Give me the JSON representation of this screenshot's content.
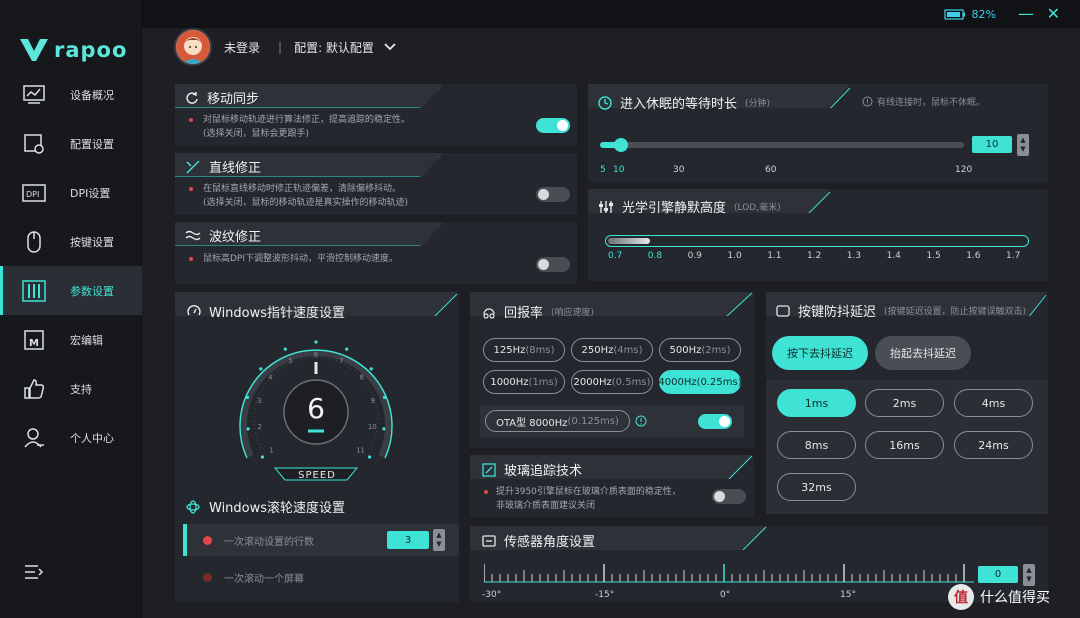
{
  "brand": {
    "name": "rapoo",
    "accent": "#3ee3d6"
  },
  "sidebar": {
    "items": [
      {
        "label": "设备概况",
        "icon": "monitor-chart-icon"
      },
      {
        "label": "配置设置",
        "icon": "config-gear-icon"
      },
      {
        "label": "DPI设置",
        "icon": "dpi-icon"
      },
      {
        "label": "按键设置",
        "icon": "mouse-icon"
      },
      {
        "label": "参数设置",
        "icon": "sliders-icon",
        "active": true
      },
      {
        "label": "宏编辑",
        "icon": "macro-icon"
      },
      {
        "label": "支持",
        "icon": "thumbs-up-icon"
      },
      {
        "label": "个人中心",
        "icon": "user-center-icon"
      }
    ]
  },
  "topbar": {
    "battery": "82%"
  },
  "user": {
    "login_status": "未登录",
    "config_label": "配置: 默认配置"
  },
  "move_sync": {
    "title": "移动同步",
    "desc1": "对鼠标移动轨迹进行算法修正，提高追踪的稳定性。",
    "desc2": "(选择关闭，鼠标会更跟手)",
    "enabled": true
  },
  "line_fix": {
    "title": "直线修正",
    "desc1": "在鼠标直线移动时修正轨迹偏差，清除偏移抖动。",
    "desc2": "(选择关闭，鼠标的移动轨迹是真实操作的移动轨迹)",
    "enabled": false
  },
  "ripple_fix": {
    "title": "波纹修正",
    "desc1": "鼠标高DPI下调整波形抖动，平滑控制移动速度。",
    "enabled": false
  },
  "sleep": {
    "title": "进入休眠的等待时长",
    "unit": "(分钟)",
    "note": "有线连接时，鼠标不休眠。",
    "value": "10",
    "ticks": [
      "5",
      "10",
      "30",
      "60",
      "120"
    ]
  },
  "lod": {
    "title": "光学引擎静默高度",
    "unit": "(LOD,毫米)",
    "ticks": [
      "0.7",
      "0.8",
      "0.9",
      "1.0",
      "1.1",
      "1.2",
      "1.3",
      "1.4",
      "1.5",
      "1.6",
      "1.7"
    ],
    "value": 0.8
  },
  "pointer_speed": {
    "title": "Windows指针速度设置",
    "value": "6",
    "label": "SPEED",
    "dial_numbers": [
      "1",
      "2",
      "3",
      "4",
      "5",
      "6",
      "7",
      "8",
      "9",
      "10",
      "11"
    ]
  },
  "scroll_speed": {
    "title": "Windows滚轮速度设置",
    "row1": "一次滚动设置的行数",
    "row1_value": "3",
    "row2": "一次滚动一个屏幕"
  },
  "polling": {
    "title": "回报率",
    "unit": "(响应速度)",
    "options": [
      {
        "label": "125Hz",
        "sub": "(8ms)"
      },
      {
        "label": "250Hz",
        "sub": "(4ms)"
      },
      {
        "label": "500Hz",
        "sub": "(2ms)"
      },
      {
        "label": "1000Hz",
        "sub": "(1ms)"
      },
      {
        "label": "2000Hz",
        "sub": "(0.5ms)"
      },
      {
        "label": "4000Hz",
        "sub": "(0.25ms)",
        "selected": true
      }
    ],
    "ota_label": "OTA型 8000Hz",
    "ota_sub": "(0.125ms)",
    "ota_enabled": true
  },
  "glass": {
    "title": "玻璃追踪技术",
    "desc1": "提升3950引擎鼠标在玻璃介质表面的稳定性，",
    "desc2": "非玻璃介质表面建议关闭",
    "enabled": false
  },
  "debounce": {
    "title": "按键防抖延迟",
    "unit": "(按键延迟设置，防止按键误触双击)",
    "btn_press": "按下去抖延迟",
    "btn_release": "抬起去抖延迟",
    "options": [
      "1ms",
      "2ms",
      "4ms",
      "8ms",
      "16ms",
      "24ms",
      "32ms"
    ],
    "selected": "1ms"
  },
  "angle": {
    "title": "传感器角度设置",
    "value": "0",
    "ticks": [
      "-30°",
      "-15°",
      "0°",
      "15°"
    ]
  },
  "watermark": "什么值得买"
}
